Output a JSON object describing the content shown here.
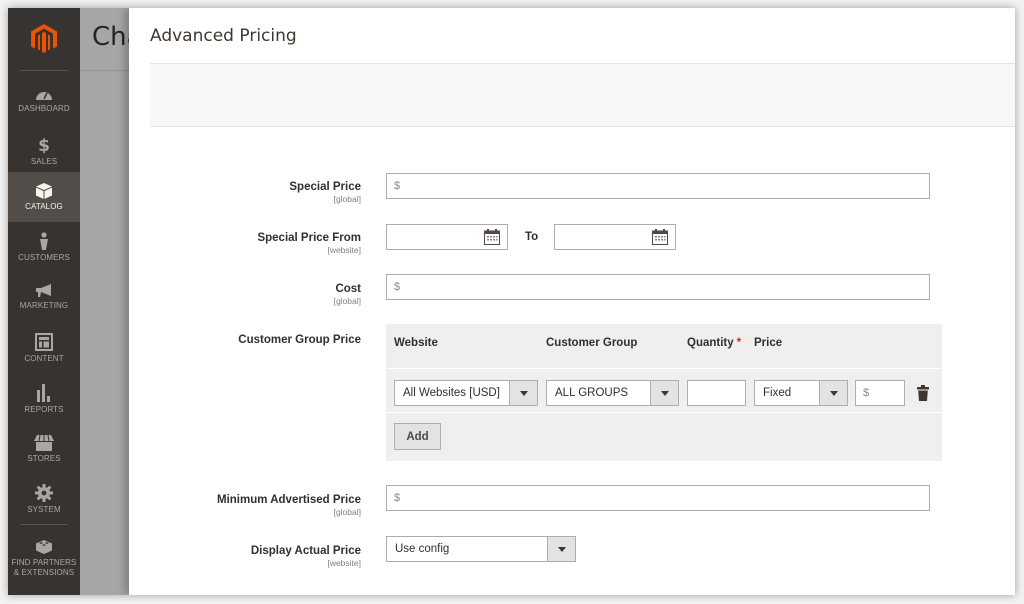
{
  "sidebar": {
    "logo": "magento-logo",
    "items": [
      {
        "label": "Dashboard",
        "icon": "dashboard-icon",
        "active": false
      },
      {
        "label": "Sales",
        "icon": "dollar-icon",
        "active": false
      },
      {
        "label": "Catalog",
        "icon": "box-icon",
        "active": true
      },
      {
        "label": "Customers",
        "icon": "person-icon",
        "active": false
      },
      {
        "label": "Marketing",
        "icon": "megaphone-icon",
        "active": false
      },
      {
        "label": "Content",
        "icon": "layout-icon",
        "active": false
      },
      {
        "label": "Reports",
        "icon": "bar-chart-icon",
        "active": false
      },
      {
        "label": "Stores",
        "icon": "storefront-icon",
        "active": false
      },
      {
        "label": "System",
        "icon": "gear-icon",
        "active": false
      },
      {
        "label": "Find Partners & Extensions",
        "icon": "blocks-icon",
        "active": false
      }
    ]
  },
  "background_page": {
    "title_fragment": "Cha"
  },
  "modal": {
    "title": "Advanced Pricing",
    "fields": {
      "special_price": {
        "label": "Special Price",
        "scope": "[global]",
        "placeholder": "$",
        "value": ""
      },
      "special_price_from": {
        "label": "Special Price From",
        "scope": "[website]",
        "from_value": "",
        "to_label": "To",
        "to_value": ""
      },
      "cost": {
        "label": "Cost",
        "scope": "[global]",
        "placeholder": "$",
        "value": ""
      },
      "customer_group_price": {
        "label": "Customer Group Price",
        "columns": {
          "website": "Website",
          "customer_group": "Customer Group",
          "quantity": "Quantity",
          "quantity_required": "*",
          "price": "Price"
        },
        "rows": [
          {
            "website": "All Websites [USD]",
            "customer_group": "ALL GROUPS",
            "quantity": "",
            "price_type": "Fixed",
            "price_placeholder": "$",
            "price": ""
          }
        ],
        "add_label": "Add"
      },
      "msrp": {
        "label": "Minimum Advertised Price",
        "scope": "[global]",
        "placeholder": "$",
        "value": ""
      },
      "display_actual_price": {
        "label": "Display Actual Price",
        "scope": "[website]",
        "value": "Use config"
      }
    }
  }
}
